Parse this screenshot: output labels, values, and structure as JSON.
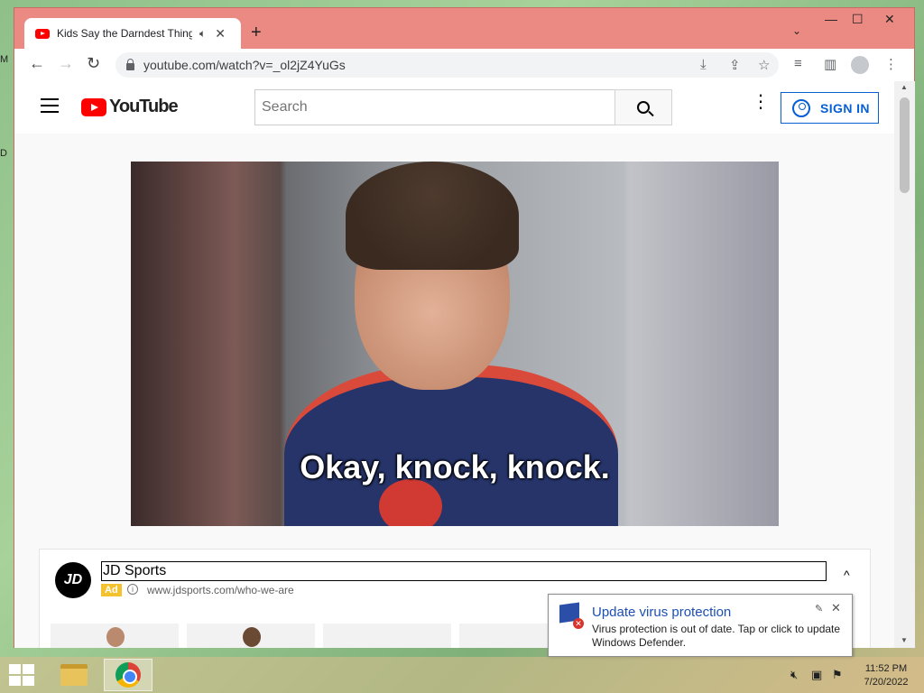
{
  "desktop": {
    "edge_glyph_1": "M",
    "edge_glyph_2": "D"
  },
  "browser": {
    "tab": {
      "title": "Kids Say the Darndest Things",
      "audio_icon": "speaker-icon",
      "close": "✕"
    },
    "new_tab": "+",
    "tab_menu": "⌄",
    "window_controls": {
      "minimize": "—",
      "maximize": "☐",
      "close": "✕"
    },
    "nav": {
      "back": "←",
      "forward": "→",
      "reload": "↻"
    },
    "url": "youtube.com/watch?v=_ol2jZ4YuGs",
    "toolbar_icons": [
      "install-icon",
      "share-icon",
      "bookmark-star-icon",
      "reading-list-icon",
      "side-panel-icon",
      "profile-icon",
      "menu-icon"
    ]
  },
  "youtube": {
    "logo_text": "YouTube",
    "search_placeholder": "Search",
    "signin_label": "SIGN IN",
    "video_caption": "Okay, knock, knock."
  },
  "ad": {
    "logo_text": "JD",
    "title": "JD Sports",
    "badge": "Ad",
    "url": "www.jdsports.com/who-we-are",
    "collapse": "^"
  },
  "notification": {
    "title": "Update virus protection",
    "body": "Virus protection is out of date. Tap or click to update Windows Defender."
  },
  "taskbar": {
    "time": "11:52 PM",
    "date": "7/20/2022"
  },
  "colors": {
    "window_frame": "#ea8a82",
    "youtube_red": "#ff0000",
    "signin_blue": "#065fd4",
    "ad_badge": "#f5c22f",
    "notification_title": "#1c4fb5"
  }
}
